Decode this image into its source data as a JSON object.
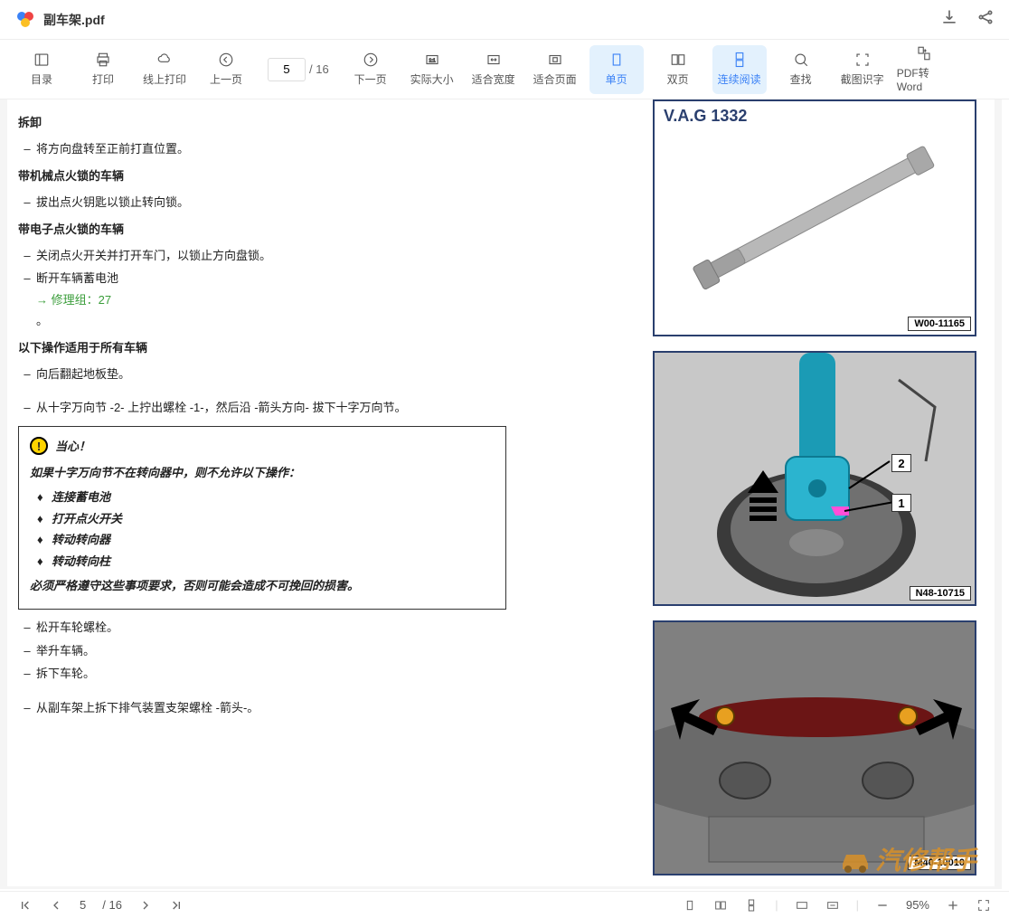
{
  "header": {
    "filename": "副车架.pdf"
  },
  "toolbar": {
    "page_current": "5",
    "page_sep": "/ 16",
    "items": {
      "toc": "目录",
      "print": "打印",
      "online_print": "线上打印",
      "prev": "上一页",
      "next": "下一页",
      "actual": "实际大小",
      "fit_width": "适合宽度",
      "fit_page": "适合页面",
      "single": "单页",
      "double": "双页",
      "continuous": "连续阅读",
      "find": "查找",
      "ocr": "截图识字",
      "to_word": "PDF转Word"
    }
  },
  "doc": {
    "h1": "拆卸",
    "l1": "将方向盘转至正前打直位置。",
    "h2": "带机械点火锁的车辆",
    "l2": "拔出点火钥匙以锁止转向锁。",
    "h3": "带电子点火锁的车辆",
    "l3": "关闭点火开关并打开车门，以锁止方向盘锁。",
    "l4a": "断开车辆蓄电池",
    "l4b": "→ 修理组：27",
    "l4c": "。",
    "h4": "以下操作适用于所有车辆",
    "l5": "向后翻起地板垫。",
    "l6": "从十字万向节 -2- 上拧出螺栓 -1-，然后沿 -箭头方向- 拔下十字万向节。",
    "warn": {
      "title": "当心！",
      "p1": "如果十字万向节不在转向器中，则不允许以下操作：",
      "li1": "连接蓄电池",
      "li2": "打开点火开关",
      "li3": "转动转向器",
      "li4": "转动转向柱",
      "p2": "必须严格遵守这些事项要求，否则可能会造成不可挽回的损害。"
    },
    "l7": "松开车轮螺栓。",
    "l8": "举升车辆。",
    "l9": "拆下车轮。",
    "l10": "从副车架上拆下排气装置支架螺栓 -箭头-。"
  },
  "figures": {
    "f1_title": "V.A.G 1332",
    "f1_label": "W00-11165",
    "f2_label": "N48-10715",
    "f2_c1": "1",
    "f2_c2": "2",
    "f3_label": "M40-10010"
  },
  "watermark": "汽修帮手",
  "status": {
    "page": "5",
    "sep": "/ 16",
    "zoom": "95%"
  }
}
